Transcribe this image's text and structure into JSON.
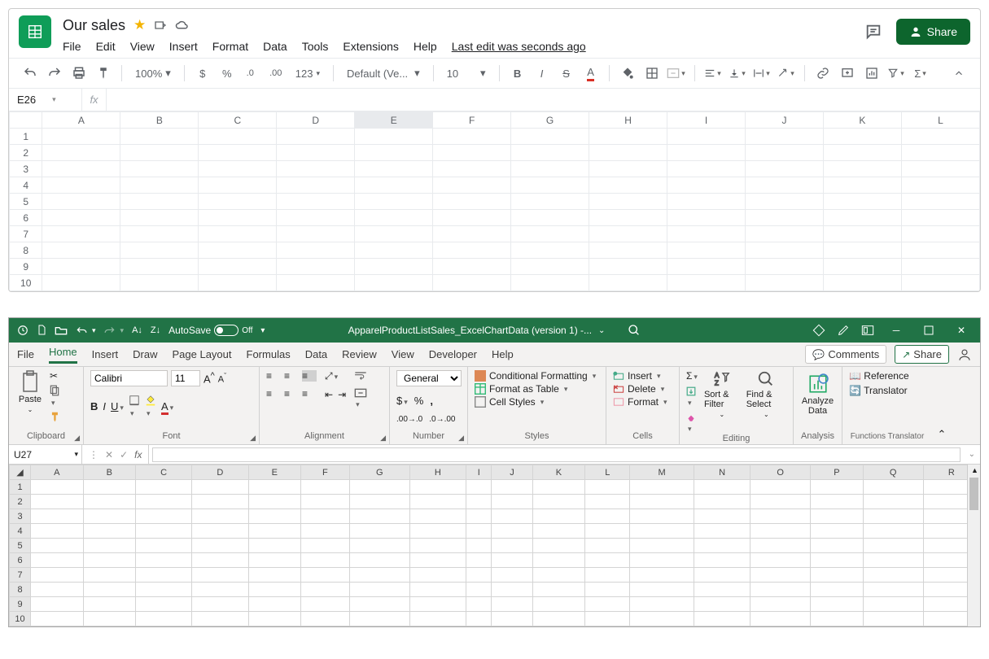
{
  "sheets": {
    "title": "Our sales",
    "menus": [
      "File",
      "Edit",
      "View",
      "Insert",
      "Format",
      "Data",
      "Tools",
      "Extensions",
      "Help"
    ],
    "last_edit": "Last edit was seconds ago",
    "share": "Share",
    "zoom": "100%",
    "font": "Default (Ve...",
    "fontsize": "10",
    "formats": {
      "dollar": "$",
      "percent": "%",
      "dec_dec": ".0",
      "dec_inc": ".00",
      "num": "123"
    },
    "cellref": "E26",
    "columns": [
      "A",
      "B",
      "C",
      "D",
      "E",
      "F",
      "G",
      "H",
      "I",
      "J",
      "K",
      "L"
    ],
    "rows": [
      "1",
      "2",
      "3",
      "4",
      "5",
      "6",
      "7",
      "8",
      "9",
      "10"
    ],
    "selected_col": "E"
  },
  "excel": {
    "autosave_label": "AutoSave",
    "autosave_state": "Off",
    "filename": "ApparelProductListSales_ExcelChartData (version 1) -...",
    "tabs": [
      "File",
      "Home",
      "Insert",
      "Draw",
      "Page Layout",
      "Formulas",
      "Data",
      "Review",
      "View",
      "Developer",
      "Help"
    ],
    "active_tab": "Home",
    "comments": "Comments",
    "share": "Share",
    "cellref": "U27",
    "ribbon": {
      "clipboard": "Clipboard",
      "paste": "Paste",
      "font": "Font",
      "fontname": "Calibri",
      "fontsize": "11",
      "alignment": "Alignment",
      "number": "Number",
      "number_format": "General",
      "styles": "Styles",
      "cond_format": "Conditional Formatting",
      "format_table": "Format as Table",
      "cell_styles": "Cell Styles",
      "cells": "Cells",
      "insert": "Insert",
      "delete": "Delete",
      "format": "Format",
      "editing": "Editing",
      "sort_filter": "Sort & Filter",
      "find_select": "Find & Select",
      "analysis": "Analysis",
      "analyze_data": "Analyze Data",
      "ft": "Functions Translator",
      "reference": "Reference",
      "translator": "Translator"
    },
    "columns": [
      "A",
      "B",
      "C",
      "D",
      "E",
      "F",
      "G",
      "H",
      "I",
      "J",
      "K",
      "L",
      "M",
      "N",
      "O",
      "P",
      "Q",
      "R"
    ],
    "rows": [
      "1",
      "2",
      "3",
      "4",
      "5",
      "6",
      "7",
      "8",
      "9",
      "10"
    ]
  }
}
